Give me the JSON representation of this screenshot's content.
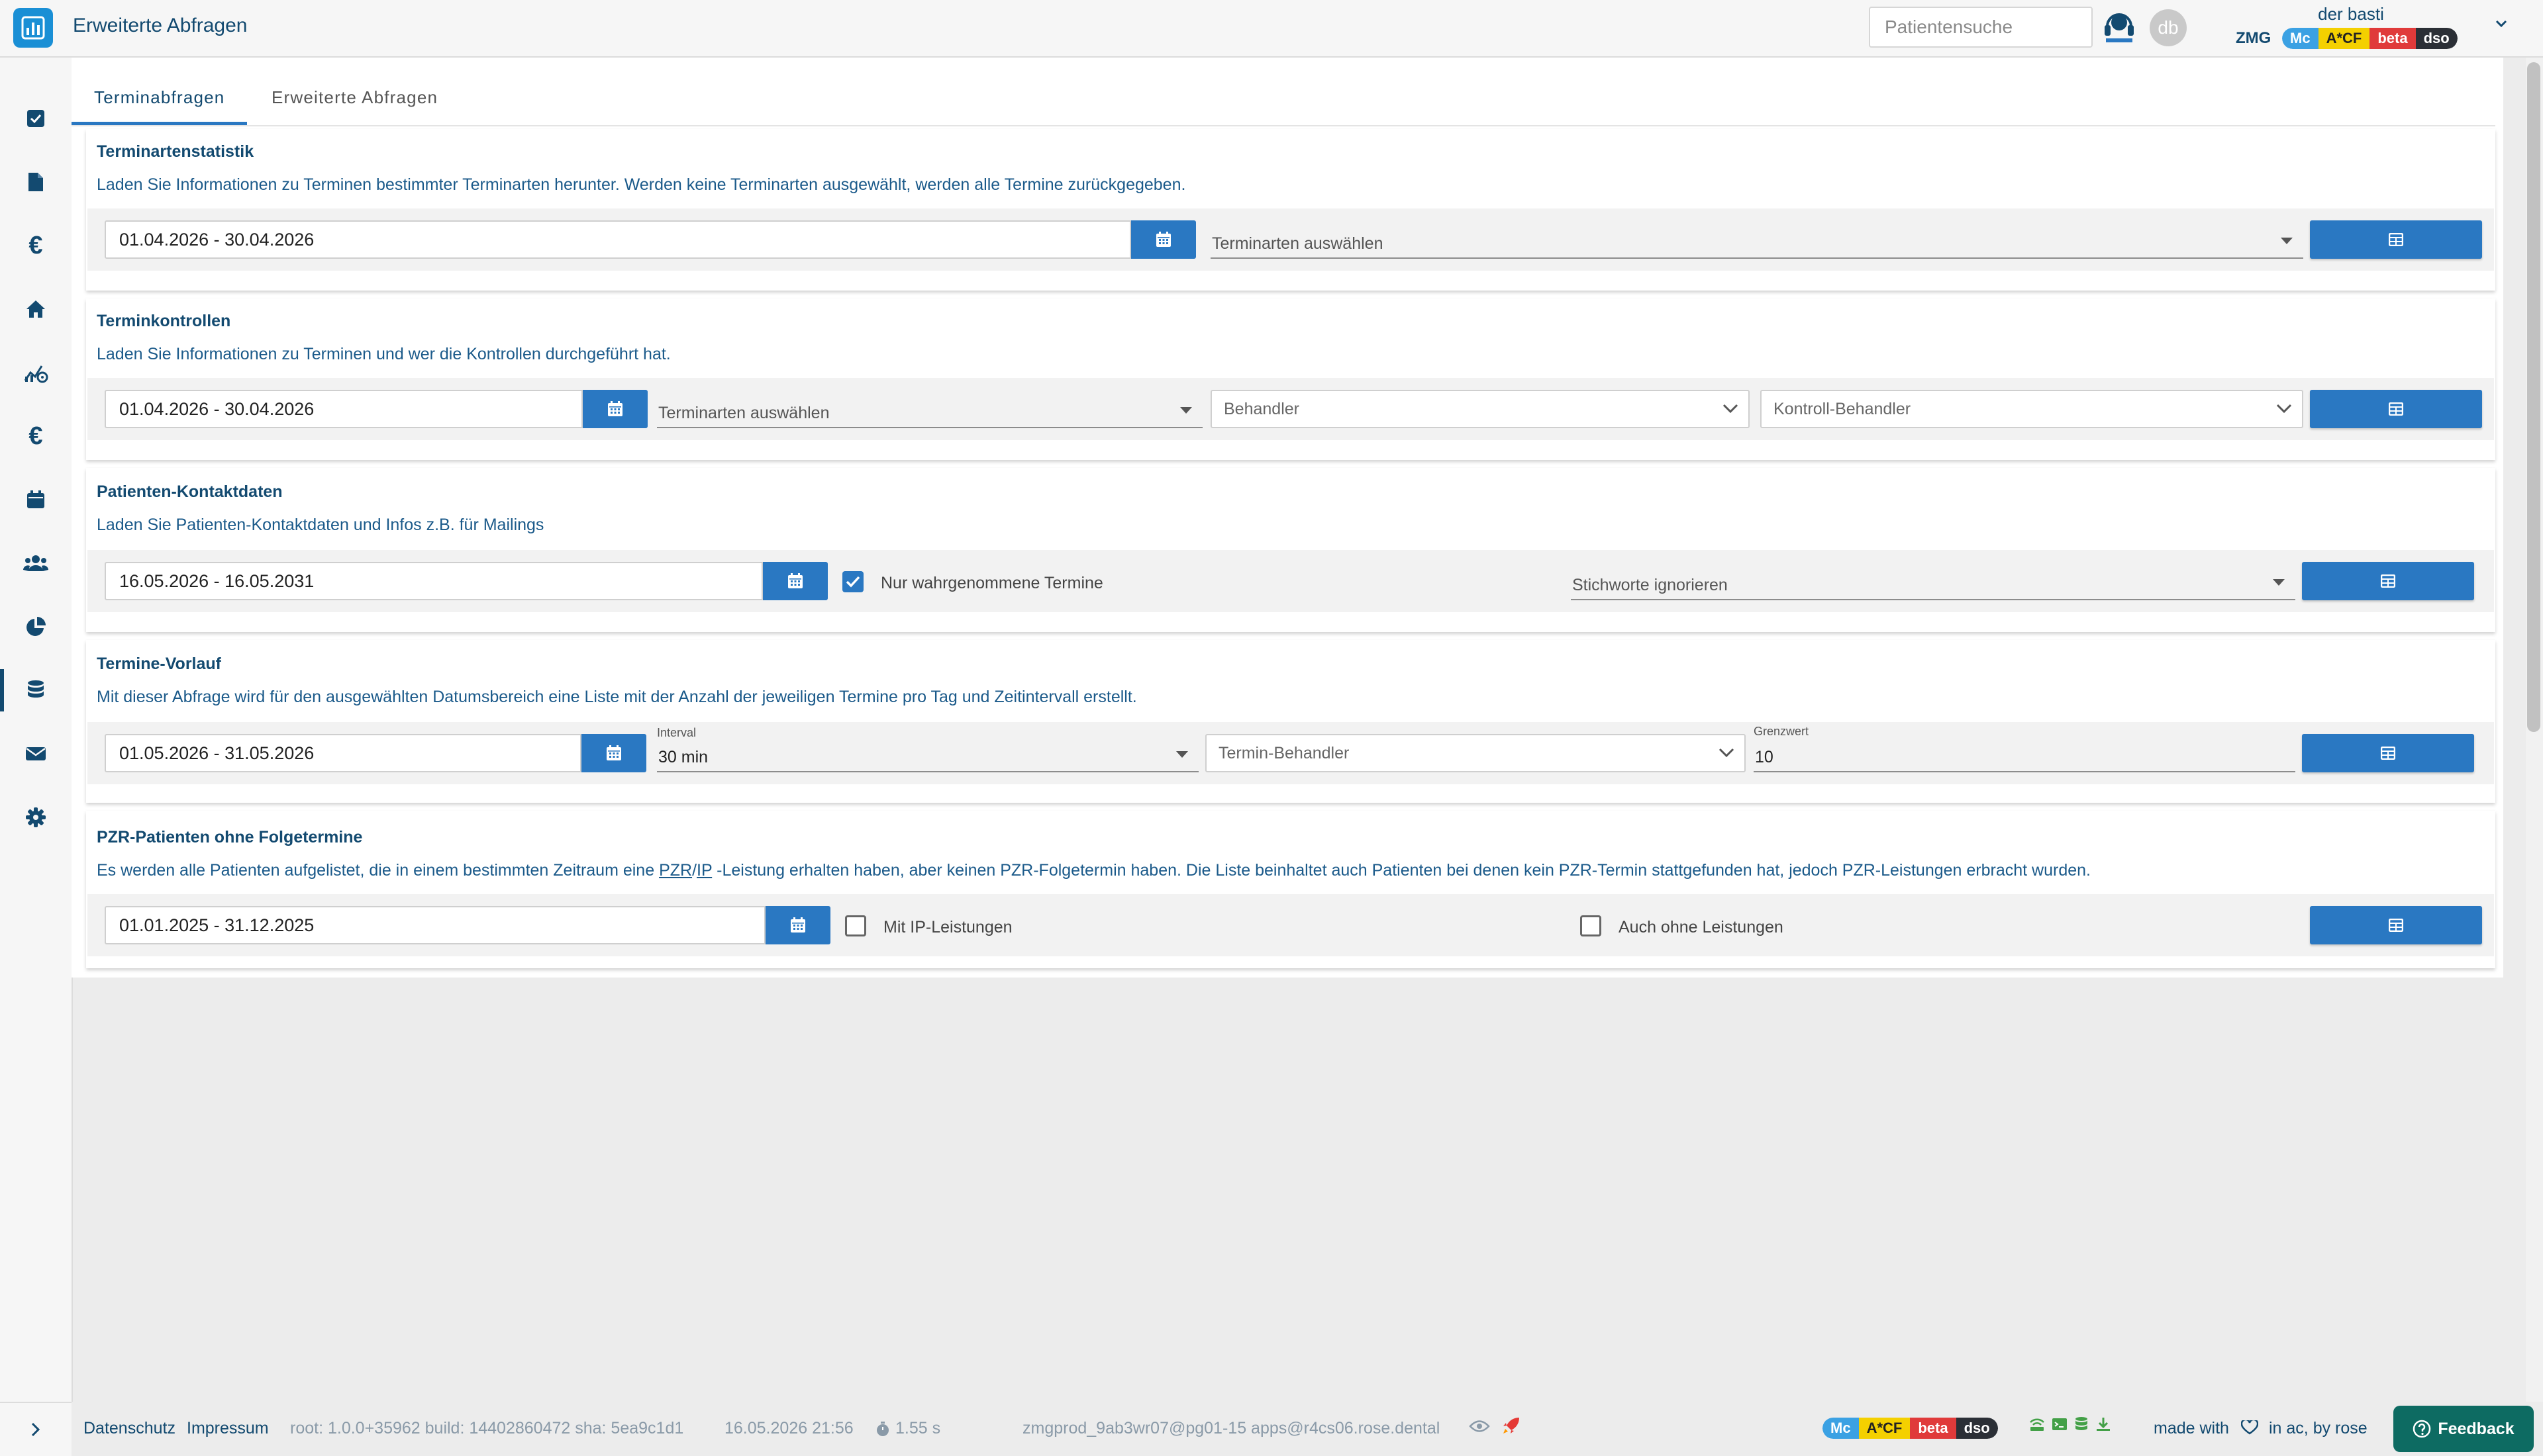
{
  "header": {
    "title": "Erweiterte Abfragen",
    "search_placeholder": "Patientensuche",
    "avatar_initials": "db",
    "user_name": "der basti",
    "tenant": "ZMG",
    "badges": [
      "Mc",
      "A*CF",
      "beta",
      "dso"
    ]
  },
  "sidebar": {
    "items": [
      "task-check-icon",
      "document-icon",
      "euro-icon",
      "home-icon",
      "stats-gear-icon",
      "euro-icon",
      "calendar-icon",
      "users-icon",
      "pie-chart-icon",
      "database-icon",
      "mail-icon",
      "settings-icon"
    ],
    "euro_symbol": "€",
    "active_index": 9
  },
  "tabs": [
    {
      "label": "Terminabfragen",
      "active": true
    },
    {
      "label": "Erweiterte Abfragen",
      "active": false
    }
  ],
  "cards": {
    "terminartenstatistik": {
      "title": "Terminartenstatistik",
      "description": "Laden Sie Informationen zu Terminen bestimmter Terminarten herunter. Werden keine Terminarten ausgewählt, werden alle Termine zurückgegeben.",
      "date_range": "01.04.2026 - 30.04.2026",
      "terminarten_placeholder": "Terminarten auswählen"
    },
    "terminkontrollen": {
      "title": "Terminkontrollen",
      "description": "Laden Sie Informationen zu Terminen und wer die Kontrollen durchgeführt hat.",
      "date_range": "01.04.2026 - 30.04.2026",
      "terminarten_placeholder": "Terminarten auswählen",
      "behandler_placeholder": "Behandler",
      "kontroll_behandler_placeholder": "Kontroll-Behandler"
    },
    "patienten_kontaktdaten": {
      "title": "Patienten-Kontaktdaten",
      "description": "Laden Sie Patienten-Kontaktdaten und Infos z.B. für Mailings",
      "date_range": "16.05.2026 - 16.05.2031",
      "checkbox_label": "Nur wahrgenommene Termine",
      "checkbox_checked": true,
      "stichworte_placeholder": "Stichworte ignorieren"
    },
    "termine_vorlauf": {
      "title": "Termine-Vorlauf",
      "description": "Mit dieser Abfrage wird für den ausgewählten Datumsbereich eine Liste mit der Anzahl der jeweiligen Termine pro Tag und Zeitintervall erstellt.",
      "date_range": "01.05.2026 - 31.05.2026",
      "interval_label": "Interval",
      "interval_value": "30 min",
      "behandler_placeholder": "Termin-Behandler",
      "grenzwert_label": "Grenzwert",
      "grenzwert_value": "10"
    },
    "pzr_patienten": {
      "title": "PZR-Patienten ohne Folgetermine",
      "description_pre": "Es werden alle Patienten aufgelistet, die in einem bestimmten Zeitraum eine ",
      "description_link1": "PZR",
      "description_sep": "/",
      "description_link2": "IP",
      "description_post": " -Leistung erhalten haben, aber keinen PZR-Folgetermin haben. Die Liste beinhaltet auch Patienten bei denen kein PZR-Termin stattgefunden hat, jedoch PZR-Leistungen erbracht wurden.",
      "date_range": "01.01.2025 - 31.12.2025",
      "checkbox1_label": "Mit IP-Leistungen",
      "checkbox1_checked": false,
      "checkbox2_label": "Auch ohne Leistungen",
      "checkbox2_checked": false
    }
  },
  "footer": {
    "datenschutz": "Datenschutz",
    "impressum": "Impressum",
    "version_info": "root: 1.0.0+35962  build: 14402860472  sha: 5ea9c1d1",
    "timestamp": "16.05.2026 21:56",
    "load_time": "1.55 s",
    "server_info": "zmgprod_9ab3wr07@pg01-15  apps@r4cs06.rose.dental",
    "badges": [
      "Mc",
      "A*CF",
      "beta",
      "dso"
    ],
    "made_with": "made with",
    "made_by": "in ac, by rose",
    "feedback_label": "Feedback"
  },
  "colors": {
    "primary": "#2a78c2",
    "navy": "#134a70",
    "brand": "#1a8fd5",
    "feedback": "#0d6b62"
  }
}
